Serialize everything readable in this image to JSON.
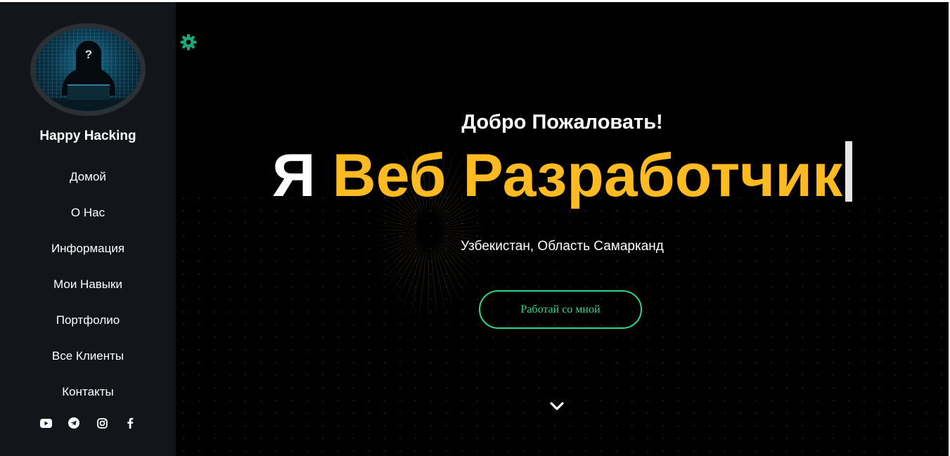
{
  "sidebar": {
    "site_name": "Happy Hacking",
    "avatar_question": "?",
    "nav": [
      {
        "label": "Домой"
      },
      {
        "label": "О Нас"
      },
      {
        "label": "Информация"
      },
      {
        "label": "Мои Навыки"
      },
      {
        "label": "Портфолио"
      },
      {
        "label": "Все Клиенты"
      },
      {
        "label": "Контакты"
      }
    ],
    "social_icons": [
      "youtube-icon",
      "telegram-icon",
      "instagram-icon",
      "facebook-icon"
    ]
  },
  "hero": {
    "welcome": "Добро Пожаловать!",
    "headline_prefix": "Я",
    "headline_role": "Веб Разработчик",
    "location": "Узбекистан, Область Самарканд",
    "cta_label": "Работай со мной"
  },
  "colors": {
    "sidebar_bg": "#12161b",
    "accent_yellow": "#fdbb21",
    "accent_green": "#2ed48c",
    "gear_green": "#1fa67a"
  }
}
